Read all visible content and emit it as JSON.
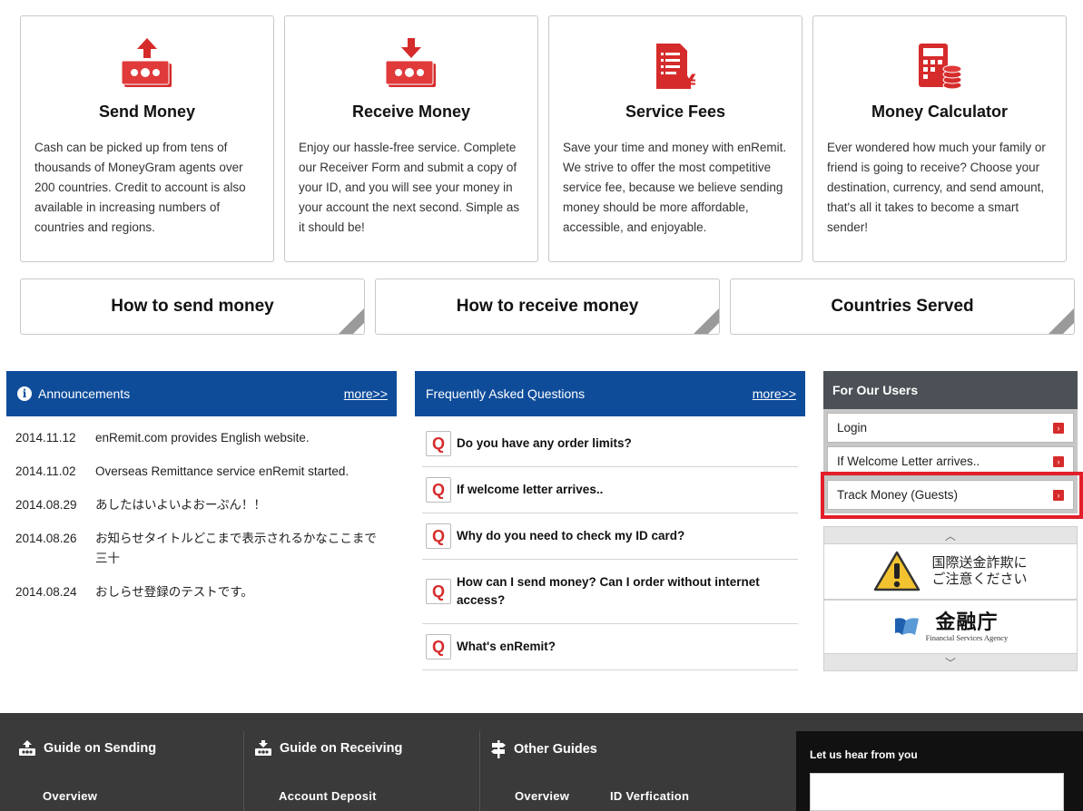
{
  "cards": [
    {
      "icon": "send-money-icon",
      "title": "Send Money",
      "text": "Cash can be picked up from tens of thousands of MoneyGram agents over 200 countries. Credit to account is also available in increasing numbers of countries and regions."
    },
    {
      "icon": "receive-money-icon",
      "title": "Receive Money",
      "text": "Enjoy our hassle-free service. Complete our Receiver Form and submit a copy of your ID, and you will see your money in your account the next second. Simple as it should be!"
    },
    {
      "icon": "service-fees-icon",
      "title": "Service Fees",
      "text": "Save your time and money with enRemit. We strive to offer the most competitive service fee, because we believe sending money should be more affordable, accessible, and enjoyable."
    },
    {
      "icon": "calculator-icon",
      "title": "Money Calculator",
      "text": "Ever wondered how much your family or friend is going to receive? Choose your destination, currency, and send amount, that's all it takes to become a smart sender!"
    }
  ],
  "biglinks": [
    "How to send money",
    "How to receive money",
    "Countries Served"
  ],
  "announcements": {
    "title": "Announcements",
    "more": "more>>",
    "items": [
      {
        "date": "2014.11.12",
        "text": "enRemit.com provides English website."
      },
      {
        "date": "2014.11.02",
        "text": "Overseas Remittance service enRemit started."
      },
      {
        "date": "2014.08.29",
        "text": "あしたはいよいよおーぷん！！"
      },
      {
        "date": "2014.08.26",
        "text": "お知らせタイトルどこまで表示されるかなここまで三十"
      },
      {
        "date": "2014.08.24",
        "text": "おしらせ登録のテストです。"
      }
    ]
  },
  "faq": {
    "title": "Frequently Asked Questions",
    "more": "more>>",
    "q_mark": "Q",
    "items": [
      "Do you have any order limits?",
      "If welcome letter arrives..",
      "Why do you need to check my ID card?",
      "How can I send money? Can I order without internet access?",
      "What's enRemit?"
    ]
  },
  "users": {
    "title": "For Our Users",
    "items": [
      "Login",
      "If Welcome Letter arrives..",
      "Track Money (Guests)"
    ]
  },
  "banners": {
    "warning_line1": "国際送金詐欺に",
    "warning_line2": "ご注意ください",
    "fsa_jp": "金融庁",
    "fsa_en": "Financial Services Agency"
  },
  "footer": {
    "sending": {
      "title": "Guide on Sending",
      "links": [
        "Overview"
      ]
    },
    "receiving": {
      "title": "Guide on Receiving",
      "links": [
        "Account Deposit"
      ]
    },
    "other": {
      "title": "Other Guides",
      "links": [
        "Overview",
        "ID Verfication"
      ]
    },
    "feedback_label": "Let us hear from you"
  },
  "colors": {
    "brand_blue": "#0e4c9a",
    "accent_red": "#d62b2b",
    "highlight": "#e21e2a",
    "footer": "#3a3a3a"
  }
}
